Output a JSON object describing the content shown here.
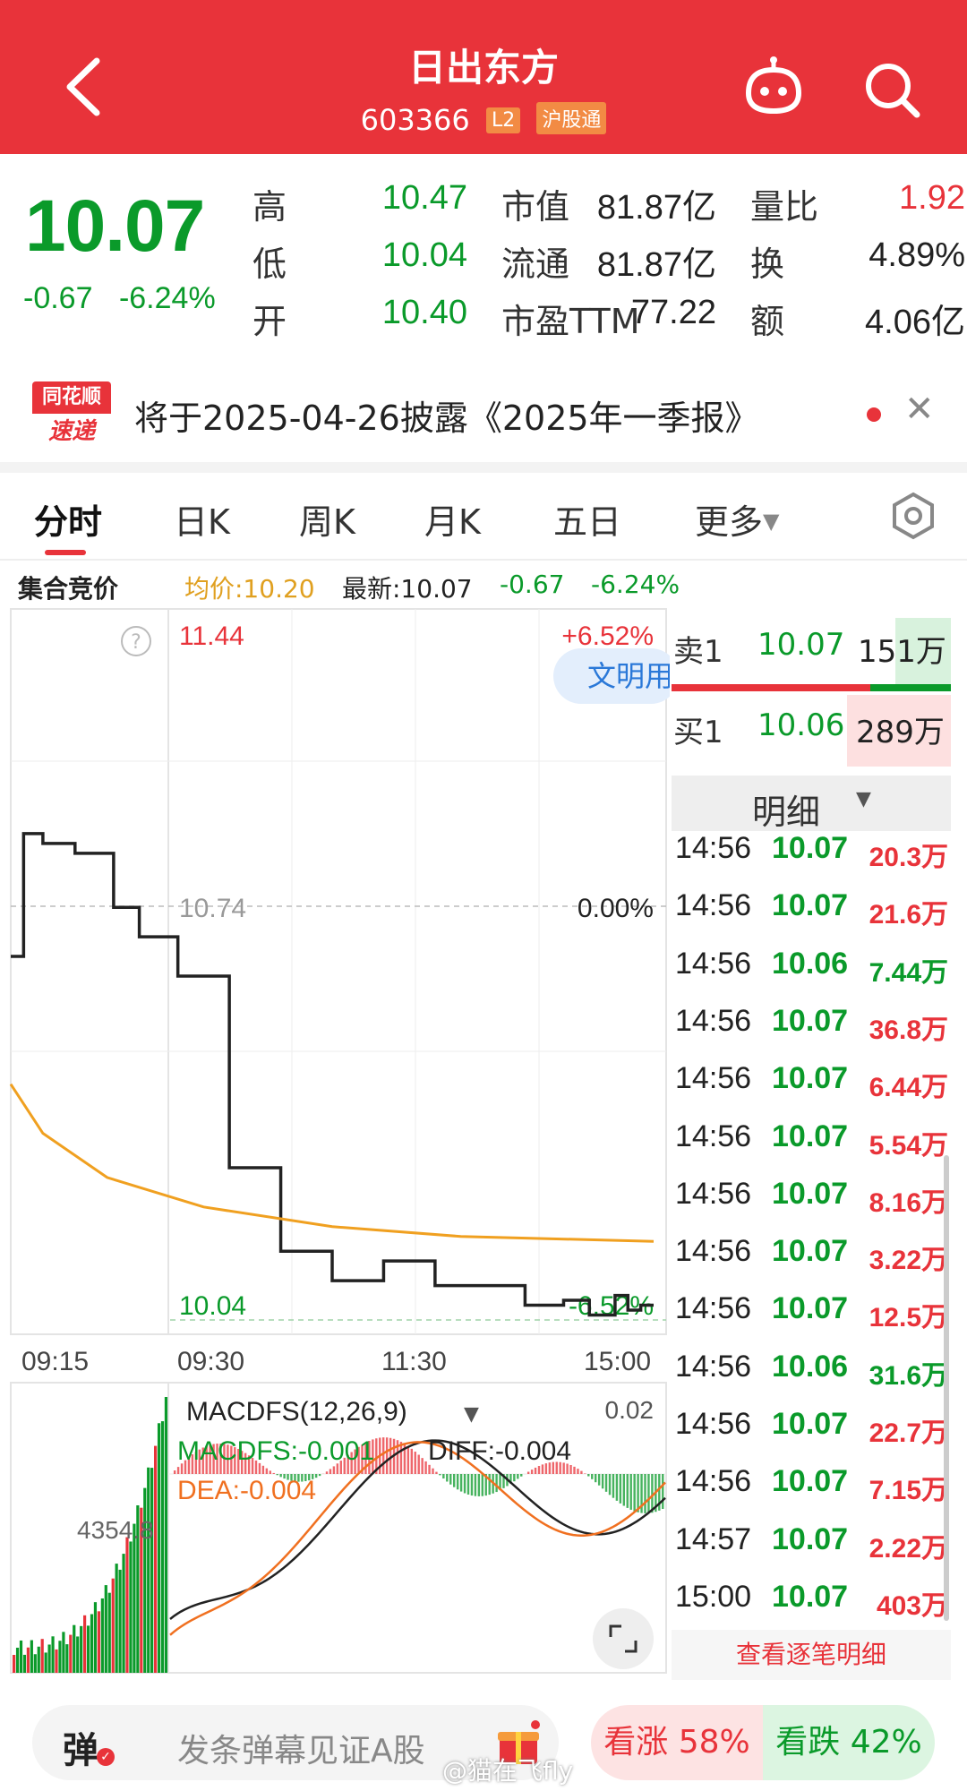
{
  "header": {
    "title": "日出东方",
    "code": "603366",
    "badge_l2": "L2",
    "badge_connect": "沪股通",
    "icons": [
      "back-arrow-icon",
      "robot-assistant-icon",
      "search-icon"
    ]
  },
  "quote": {
    "price": "10.07",
    "change": "-0.67",
    "change_pct": "-6.24%",
    "rows": [
      {
        "label1": "高",
        "value1": "10.47",
        "label2": "市值",
        "value2": "81.87亿",
        "label3": "量比",
        "value3": "1.92"
      },
      {
        "label1": "低",
        "value1": "10.04",
        "label2": "流通",
        "value2": "81.87亿",
        "label3": "换",
        "value3": "4.89%"
      },
      {
        "label1": "开",
        "value1": "10.40",
        "label2": "市盈TTM",
        "value2": "77.22",
        "label3": "额",
        "value3": "4.06亿"
      }
    ]
  },
  "notice": {
    "logo_top": "同花顺",
    "logo_bottom": "速递",
    "text": "将于2025-04-26披露《2025年一季报》"
  },
  "tabs": {
    "items": [
      "分时",
      "日K",
      "周K",
      "月K",
      "五日",
      "更多"
    ],
    "active": "分时"
  },
  "infobar": {
    "auction": "集合竞价",
    "avg": "均价:10.20",
    "latest": "最新:10.07",
    "change": "-0.67",
    "change_pct": "-6.24%"
  },
  "chart_data": {
    "type": "line",
    "title": "",
    "price_axis": {
      "top": "11.44",
      "mid": "10.74",
      "bottom": "10.04"
    },
    "pct_axis": {
      "top": "+6.52%",
      "mid": "0.00%",
      "bottom": "-6.52%"
    },
    "time_ticks": [
      "09:15",
      "09:30",
      "11:30",
      "15:00"
    ],
    "overlay_label": "文明用",
    "series": [
      {
        "name": "price",
        "color": "#222222",
        "x": [
          0,
          2,
          5,
          10,
          16,
          20,
          26,
          34,
          42,
          50,
          58,
          66,
          74,
          80,
          86,
          90,
          94,
          96,
          98,
          100
        ],
        "y": [
          10.78,
          11.03,
          11.01,
          10.99,
          10.88,
          10.82,
          10.74,
          10.35,
          10.18,
          10.12,
          10.16,
          10.11,
          10.11,
          10.07,
          10.08,
          10.05,
          10.09,
          10.06,
          10.07,
          10.07
        ]
      },
      {
        "name": "avg",
        "color": "#f0a020",
        "x": [
          0,
          5,
          15,
          30,
          50,
          70,
          100
        ],
        "y": [
          10.52,
          10.42,
          10.33,
          10.27,
          10.23,
          10.21,
          10.2
        ]
      }
    ],
    "macd": {
      "title": "MACDFS(12,26,9)",
      "macdfs": "MACDFS:-0.001",
      "diff": "DIFF:-0.004",
      "dea": "DEA:-0.004",
      "axis_top": "0.02",
      "volume_label": "4354.8"
    }
  },
  "orderbook": {
    "sell": {
      "label": "卖1",
      "price": "10.07",
      "vol": "151万"
    },
    "buy": {
      "label": "买1",
      "price": "10.06",
      "vol": "289万"
    }
  },
  "detail": {
    "title": "明细",
    "rows": [
      {
        "time": "14:56",
        "price": "10.07",
        "vol": "20.3万",
        "side": "red"
      },
      {
        "time": "14:56",
        "price": "10.07",
        "vol": "21.6万",
        "side": "red"
      },
      {
        "time": "14:56",
        "price": "10.06",
        "vol": "7.44万",
        "side": "green"
      },
      {
        "time": "14:56",
        "price": "10.07",
        "vol": "36.8万",
        "side": "red"
      },
      {
        "time": "14:56",
        "price": "10.07",
        "vol": "6.44万",
        "side": "red"
      },
      {
        "time": "14:56",
        "price": "10.07",
        "vol": "5.54万",
        "side": "red"
      },
      {
        "time": "14:56",
        "price": "10.07",
        "vol": "8.16万",
        "side": "red"
      },
      {
        "time": "14:56",
        "price": "10.07",
        "vol": "3.22万",
        "side": "red"
      },
      {
        "time": "14:56",
        "price": "10.07",
        "vol": "12.5万",
        "side": "red"
      },
      {
        "time": "14:56",
        "price": "10.06",
        "vol": "31.6万",
        "side": "green"
      },
      {
        "time": "14:56",
        "price": "10.07",
        "vol": "22.7万",
        "side": "red"
      },
      {
        "time": "14:56",
        "price": "10.07",
        "vol": "7.15万",
        "side": "red"
      },
      {
        "time": "14:57",
        "price": "10.07",
        "vol": "2.22万",
        "side": "red"
      },
      {
        "time": "15:00",
        "price": "10.07",
        "vol": "403万",
        "side": "red"
      }
    ],
    "more": "查看逐笔明细"
  },
  "bottom": {
    "danmu_icon": "弹",
    "placeholder": "发条弹幕见证A股",
    "up": "看涨 58%",
    "down": "看跌 42%",
    "watermark": "@猫在飞fly"
  },
  "colors": {
    "up": "#e8333a",
    "down": "#0a9a2a",
    "avg": "#f0a020"
  }
}
